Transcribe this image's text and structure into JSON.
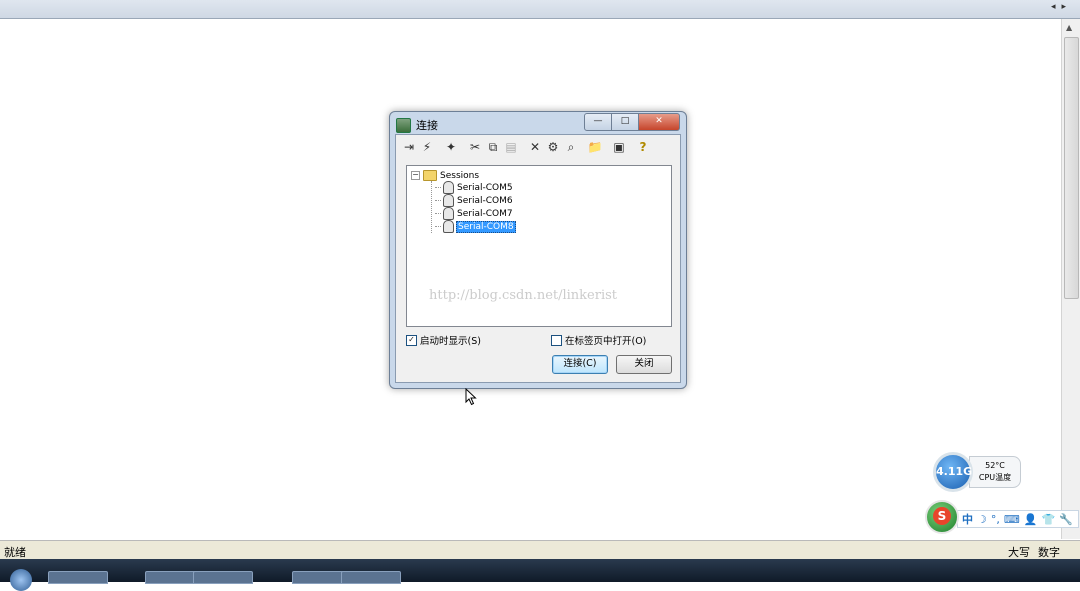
{
  "dialog": {
    "title": "连接",
    "win_minimize": "—",
    "win_maximize": "□",
    "win_close": "✕",
    "toolbar": [
      {
        "icon": "connect-icon",
        "glyph": "⇥"
      },
      {
        "icon": "quick-connect-icon",
        "glyph": "⚡"
      },
      {
        "icon": "new-session-icon",
        "glyph": "✦"
      },
      {
        "icon": "cut-icon",
        "glyph": "✂"
      },
      {
        "icon": "copy-icon",
        "glyph": "⧉"
      },
      {
        "icon": "paste-icon",
        "glyph": "▤"
      },
      {
        "icon": "delete-icon",
        "glyph": "✕"
      },
      {
        "icon": "properties-icon",
        "glyph": "⚙"
      },
      {
        "icon": "find-icon",
        "glyph": "⌕"
      },
      {
        "icon": "new-folder-icon",
        "glyph": "📁"
      },
      {
        "icon": "create-shortcut-icon",
        "glyph": "▣"
      },
      {
        "icon": "help-icon",
        "glyph": "?"
      }
    ],
    "tree": {
      "root_label": "Sessions",
      "root_expander": "−",
      "items": [
        {
          "label": "Serial-COM5"
        },
        {
          "label": "Serial-COM6"
        },
        {
          "label": "Serial-COM7"
        },
        {
          "label": "Serial-COM8",
          "selected": true
        }
      ]
    },
    "watermark": "http://blog.csdn.net/linkerist",
    "show_on_startup": {
      "label": "启动时显示(S)",
      "checked": true,
      "mark": "✓"
    },
    "open_in_tab": {
      "label": "在标签页中打开(O)",
      "checked": false
    },
    "connect_button": "连接(C)",
    "close_button": "关闭"
  },
  "statusbar": {
    "left": "就绪",
    "caps": "大写",
    "num": "数字"
  },
  "topbar": {
    "scroll_left": "◂",
    "scroll_right": "▸"
  },
  "scrollbar": {
    "up": "▲"
  },
  "cpu_gadget": {
    "usage": "4.11G",
    "temp": "52°C",
    "label": "CPU温度"
  },
  "ime": {
    "logo": "S",
    "mode": "中",
    "symbols": [
      "☽",
      "°,",
      "⌨",
      "👤",
      "👕",
      "🔧"
    ]
  }
}
